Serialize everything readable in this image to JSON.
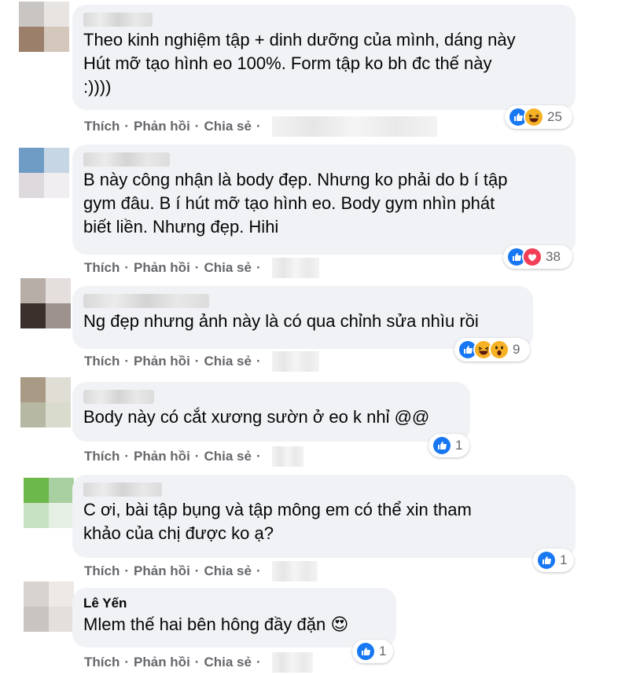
{
  "actions": {
    "like": "Thích",
    "reply": "Phản hồi",
    "share": "Chia sẻ",
    "separator": "·"
  },
  "comments": [
    {
      "name": "",
      "text": "Theo kinh nghiệm tập + dinh dưỡng của mình, dáng này\nHút mỡ tạo hình eo 100%. Form tập ko bh đc thế này\n:))))",
      "reactions": [
        "like-icon",
        "haha-icon"
      ],
      "count": "25"
    },
    {
      "name": "",
      "text": "B này công nhận là body đẹp. Nhưng ko phải do b í tập\ngym đâu. B í hút mỡ tạo hình eo. Body gym nhìn phát\nbiết liền. Nhưng đẹp. Hihi",
      "reactions": [
        "like-icon",
        "love-icon"
      ],
      "count": "38"
    },
    {
      "name": "",
      "text": "Ng đẹp nhưng ảnh này là có qua chỉnh sửa nhìu rồi",
      "reactions": [
        "like-icon",
        "haha-icon",
        "wow-icon"
      ],
      "count": "9"
    },
    {
      "name": "",
      "text": "Body này có cắt xương sườn ở eo k nhỉ @@",
      "reactions": [
        "like-icon"
      ],
      "count": "1"
    },
    {
      "name": "",
      "text": "C ơi, bài tập bụng và tập mông em có thể xin tham\nkhảo của chị được ko ạ?",
      "reactions": [
        "like-icon"
      ],
      "count": "1"
    },
    {
      "name": "Lê Yến",
      "text": "Mlem thế hai bên hông đầy đặn",
      "emoji": "😍",
      "reactions": [
        "like-icon"
      ],
      "count": "1"
    }
  ],
  "colors": {
    "like": "#1877f2",
    "love": "#f33e58",
    "haha": "#f7b125",
    "bubble": "#f0f2f5",
    "meta": "#65676b"
  }
}
